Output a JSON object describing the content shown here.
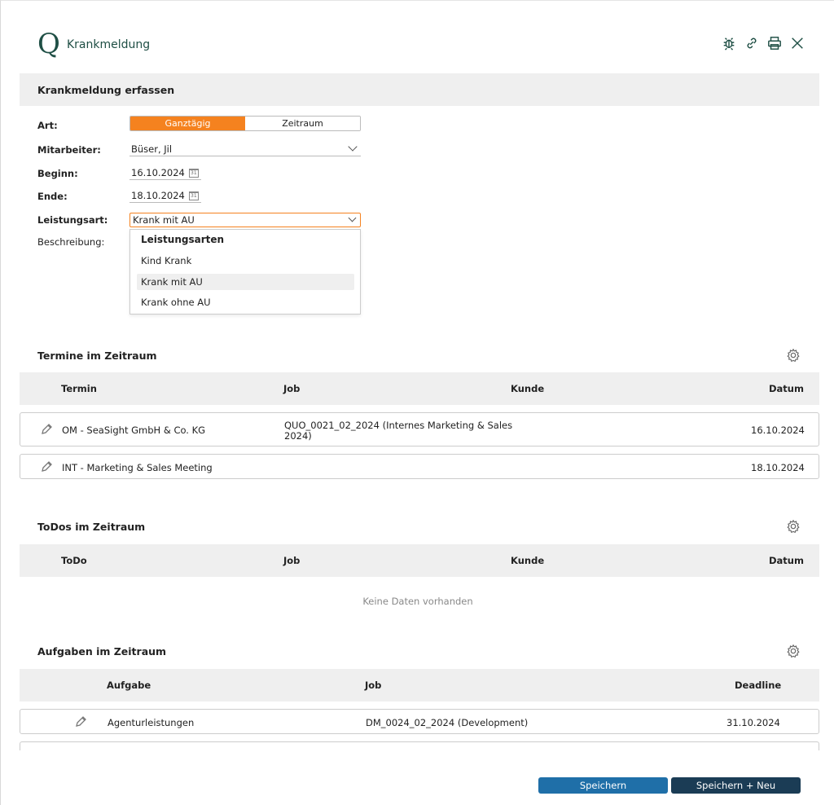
{
  "header": {
    "logo": "Q",
    "title": "Krankmeldung",
    "icons": [
      "bug-icon",
      "link-icon",
      "print-icon",
      "close-icon"
    ]
  },
  "form": {
    "section_title": "Krankmeldung erfassen",
    "art_label": "Art:",
    "art_options": [
      "Ganztägig",
      "Zeitraum"
    ],
    "art_selected": "Ganztägig",
    "mitarbeiter_label": "Mitarbeiter:",
    "mitarbeiter_value": "Büser, Jil",
    "beginn_label": "Beginn:",
    "beginn_value": "16.10.2024",
    "ende_label": "Ende:",
    "ende_value": "18.10.2024",
    "leistungsart_label": "Leistungsart:",
    "leistungsart_value": "Krank mit AU",
    "beschreibung_label": "Beschreibung:",
    "dropdown": {
      "header": "Leistungsarten",
      "options": [
        "Kind Krank",
        "Krank mit AU",
        "Krank ohne AU"
      ],
      "highlighted": "Krank mit AU"
    }
  },
  "termine": {
    "title": "Termine im Zeitraum",
    "columns": [
      "Termin",
      "Job",
      "Kunde",
      "Datum"
    ],
    "rows": [
      {
        "termin": "OM - SeaSight GmbH & Co. KG",
        "job_line1": "QUO_0021_02_2024 (Internes Marketing & Sales",
        "job_line2": "2024)",
        "kunde": "",
        "datum": "16.10.2024"
      },
      {
        "termin": "INT - Marketing & Sales Meeting",
        "job_line1": "",
        "job_line2": "",
        "kunde": "",
        "datum": "18.10.2024"
      }
    ]
  },
  "todos": {
    "title": "ToDos im Zeitraum",
    "columns": [
      "ToDo",
      "Job",
      "Kunde",
      "Datum"
    ],
    "empty": "Keine Daten vorhanden"
  },
  "aufgaben": {
    "title": "Aufgaben im Zeitraum",
    "columns": [
      "Aufgabe",
      "Job",
      "Deadline"
    ],
    "rows": [
      {
        "aufgabe": "Agenturleistungen",
        "job": "DM_0024_02_2024 (Development)",
        "deadline": "31.10.2024"
      }
    ]
  },
  "footer": {
    "save": "Speichern",
    "save_new": "Speichern + Neu"
  },
  "colors": {
    "accent": "#f5821f",
    "brand": "#1f4f45",
    "button_primary": "#1f6fa8",
    "button_dark": "#1b3c55"
  }
}
